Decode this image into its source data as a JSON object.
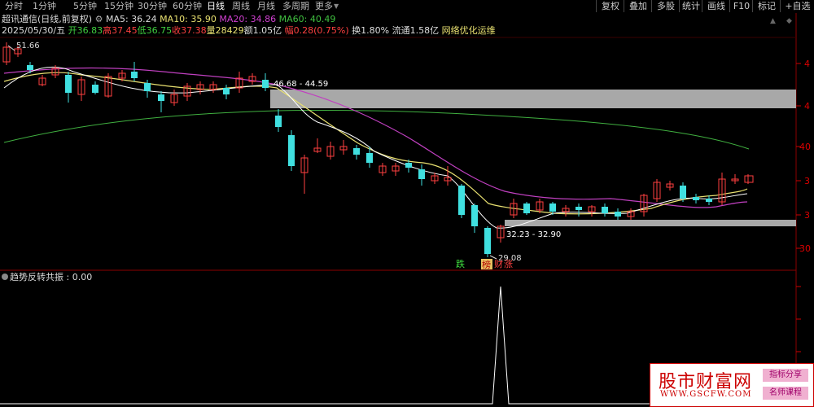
{
  "toolbar": {
    "tabs": [
      "分时",
      "1分钟",
      "5分钟",
      "15分钟",
      "30分钟",
      "60分钟",
      "日线",
      "周线",
      "月线",
      "多周期",
      "更多"
    ],
    "active_tab": "日线",
    "right_buttons": [
      "复权",
      "叠加",
      "多股",
      "统计",
      "画线",
      "F10",
      "标记",
      "+自选",
      "返回"
    ]
  },
  "header": {
    "stock_name": "超讯通信(日线,前复权)",
    "ma5_label": "MA5: 36.24",
    "ma10_label": "MA10: 35.90",
    "ma20_label": "MA20: 34.86",
    "ma60_label": "MA60: 40.49"
  },
  "info": {
    "date": "2025/05/30/五",
    "open": "开36.83",
    "high": "高37.45",
    "low": "低36.75",
    "close": "收37.38",
    "volume": "量28429",
    "amount": "额1.05亿",
    "change": "幅0.28(0.75%)",
    "turnover": "换1.80%",
    "float": "流通1.58亿",
    "concept": "网络优化运维"
  },
  "main_chart": {
    "labels": {
      "high_mark": "51.66",
      "low_mark": "29.08",
      "zone_upper": "46.68 - 44.59",
      "zone_lower": "32.23 - 32.90",
      "signal_die": "跌",
      "signal_bang": "榜",
      "signal_cai": "财",
      "signal_zhang": "涨"
    },
    "right_axis_partial": [
      "4",
      "4",
      "40",
      "3",
      "3",
      "30"
    ]
  },
  "indicator": {
    "title": "趋势反转共振 : 0.00"
  },
  "watermark": {
    "title": "股市财富网",
    "url": "WWW.GSCFW.COM",
    "tag1": "指标分享",
    "tag2": "名师课程"
  },
  "colors": {
    "up": "#ff4040",
    "down": "#40e0e0",
    "ma5": "#ffffff",
    "ma10": "#e8e070",
    "ma20": "#d040d0",
    "ma60": "#40b040",
    "zone": "#a8a8a8"
  }
}
